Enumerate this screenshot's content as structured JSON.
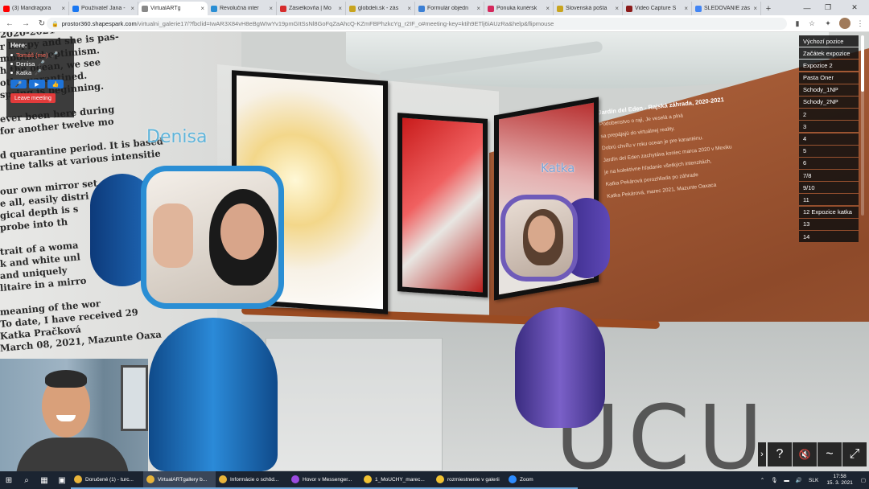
{
  "browser": {
    "tabs": [
      {
        "title": "(3) Mandragora",
        "color": "#ff0000"
      },
      {
        "title": "Používateľ Jana -",
        "color": "#1877f2"
      },
      {
        "title": "VirtualARTg",
        "color": "#888888",
        "active": true
      },
      {
        "title": "Revolučná inter",
        "color": "#2a8ed4"
      },
      {
        "title": "Zásielkovňa | Mo",
        "color": "#d62b2b"
      },
      {
        "title": "globdeli.sk - zás",
        "color": "#c8a41e"
      },
      {
        "title": "Formulár objedn",
        "color": "#3b7fd4"
      },
      {
        "title": "Ponuka kuriérsk",
        "color": "#d4285c"
      },
      {
        "title": "Slovenská pošta",
        "color": "#c8a41e"
      },
      {
        "title": "Video Capture S",
        "color": "#8b1a1a"
      },
      {
        "title": "SLEDOVANIE zás",
        "color": "#4285f4"
      }
    ],
    "new_tab": "+",
    "url_domain": "prostor360.shapespark.com",
    "url_path": "/virtualni_galerie17/?fbclid=IwAR3X84vH8eBgWIwYv19pmGItSsNl8GoFqZaAhcQ-KZmFBPhzkcYg_r2IF_o#meeting-key=ktih9ETlj6iAUzRa&help&flipmouse"
  },
  "scene": {
    "left_wall_lines": [
      "2020-2021",
      "r happy and she is pas-",
      "mbodied optimism.",
      "h the ocean, we see",
      "oth quarantined.",
      "spring is beginning.",
      "",
      "ever been here during",
      "for another twelve mo",
      "",
      "d quarantine period. It is based",
      "rtine talks at various intensitie",
      "",
      "our own mirror set",
      "e all, easily distri",
      "gical depth is s",
      "probe into th",
      "",
      "trait of a woma",
      "k and white unl",
      "and uniquely",
      "litaire in a mirro",
      "",
      "meaning of the wor",
      "To date, I have received 29",
      "Katka Pračková",
      "March 08, 2021, Mazunte Oaxa"
    ],
    "right_wall_title": "Jardín del Eden - Rajská záhrada, 2020-2021",
    "right_wall_lines": [
      "Podobenstvo o raji, Je veselá a plná",
      "sa prepájajú do virtuálnej reality.",
      "Dobrú chvíľu v roku ocean je pre karanténu.",
      "Jardín del Eden zachytáva koniec marca 2020 v Mexiku",
      "je na kolektívne hľadanie všetkých intenzitách,",
      "Katka Pekárová porozhliada po záhrade",
      "Katka Pekárová, marec 2021, Mazunte Oaxaca"
    ],
    "floor_letters": "UCU",
    "avatar_names": {
      "denisa": "Denisa",
      "katka": "Katka"
    }
  },
  "here_panel": {
    "title": "Here:",
    "participants": [
      {
        "name": "Tomáš (me)",
        "is_me": true
      },
      {
        "name": "Denisa"
      },
      {
        "name": "Katka"
      }
    ],
    "leave_label": "Leave meeting"
  },
  "nav_menu": {
    "items": [
      "Výchozí pozice",
      "Začátek expozice",
      "Expozice 2",
      "Pasta Oner",
      "Schody_1NP",
      "Schody_2NP",
      "2",
      "3",
      "4",
      "5",
      "6",
      "7/8",
      "9/10",
      "11",
      "12 Expozice katka",
      "13",
      "14"
    ]
  },
  "controls": {
    "expand": "›",
    "help": "?",
    "mute": "🔇",
    "path": "~",
    "fullscreen": "⤢"
  },
  "taskbar": {
    "apps": [
      {
        "title": "Doručené (1) - turc...",
        "color": "#e8b43a"
      },
      {
        "title": "VirtualARTgallery b...",
        "color": "#e8b43a",
        "active": true
      },
      {
        "title": "Informácie o schôd...",
        "color": "#e8b43a"
      },
      {
        "title": "Hovor v Messenger...",
        "color": "#9b4be0"
      },
      {
        "title": "1_MoUCHY_marec...",
        "color": "#f1c232"
      },
      {
        "title": "rozmiestnenie v galerii",
        "color": "#f1c232"
      },
      {
        "title": "Zoom",
        "color": "#2d8cff"
      }
    ],
    "language": "SLK",
    "time": "17:58",
    "date": "15. 3. 2021"
  }
}
